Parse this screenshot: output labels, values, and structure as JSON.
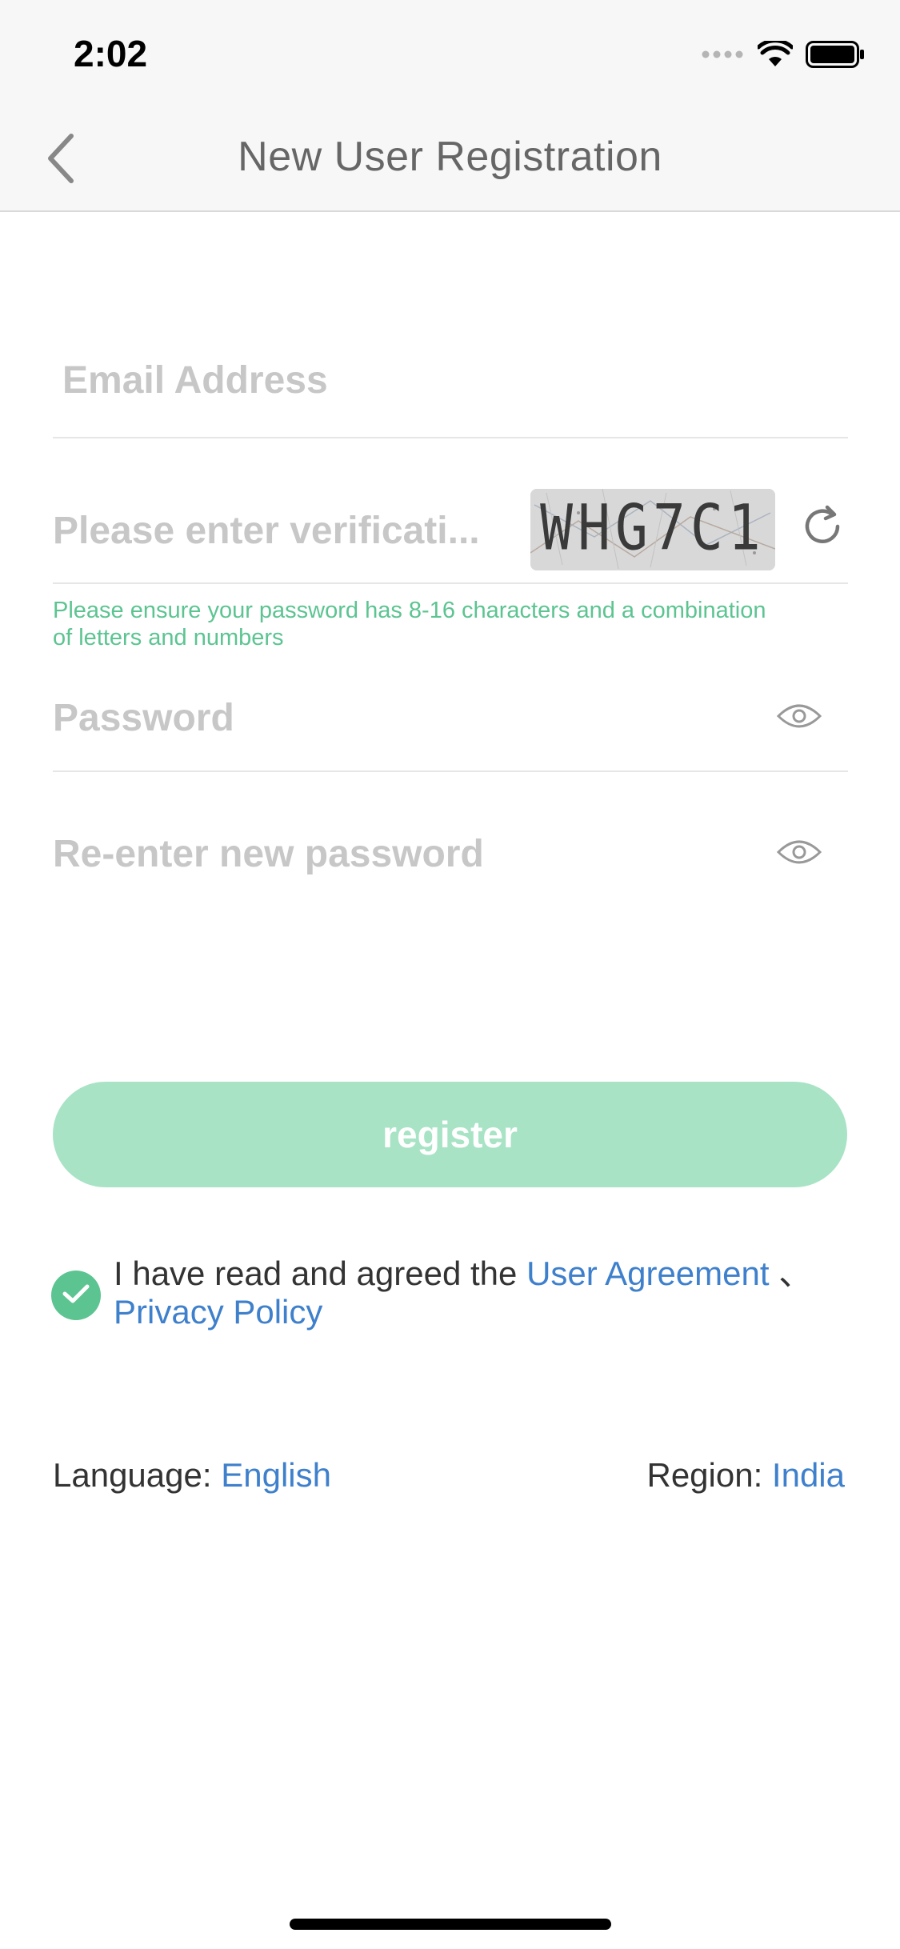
{
  "status_bar": {
    "time": "2:02"
  },
  "nav": {
    "title": "New User Registration"
  },
  "form": {
    "email_placeholder": "Email Address",
    "verification_placeholder": "Please enter verificati...",
    "captcha_text": "WHG7C1",
    "password_hint": "Please ensure your password has 8-16 characters and a combination of letters and numbers",
    "password_placeholder": "Password",
    "reenter_placeholder": "Re-enter new password"
  },
  "register": {
    "label": "register"
  },
  "agreement": {
    "prefix": "I have read and agreed the ",
    "user_agreement": "User Agreement",
    "separator": " 、",
    "privacy_policy": "Privacy Policy",
    "checked": true
  },
  "footer": {
    "language_label": "Language:",
    "language_value": "English",
    "region_label": "Region:",
    "region_value": "India"
  },
  "colors": {
    "accent_green": "#5cc491",
    "button_green_disabled": "#a8e3c5",
    "link_blue": "#3f80cc"
  }
}
